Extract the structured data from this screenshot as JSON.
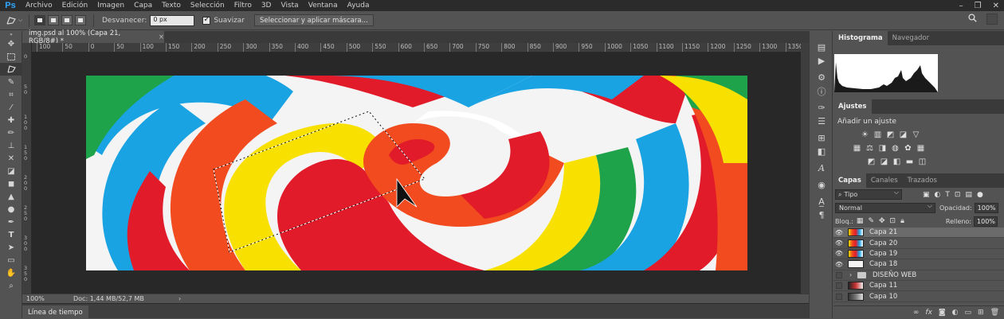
{
  "app": {
    "logo": "Ps"
  },
  "menu": [
    "Archivo",
    "Edición",
    "Imagen",
    "Capa",
    "Texto",
    "Selección",
    "Filtro",
    "3D",
    "Vista",
    "Ventana",
    "Ayuda"
  ],
  "window_controls": {
    "minimize": "–",
    "restore": "❐",
    "close": "✕"
  },
  "options_bar": {
    "feather_label": "Desvanecer:",
    "feather_value": "0 px",
    "antialias_label": "Suavizar",
    "antialias_checked": true,
    "select_mask_label": "Seleccionar y aplicar máscara..."
  },
  "document": {
    "tab_title": "img.psd al 100% (Capa 21, RGB/8#) *",
    "tab_close": "×",
    "ruler_top": [
      "100",
      "50",
      "0",
      "50",
      "100",
      "150",
      "200",
      "250",
      "300",
      "350",
      "400",
      "450",
      "500",
      "550",
      "600",
      "650",
      "700",
      "750",
      "800",
      "850",
      "900",
      "950",
      "1000",
      "1050",
      "1100",
      "1150",
      "1200",
      "1250",
      "1300",
      "1350"
    ],
    "ruler_left": [
      "0",
      "5 0",
      "1 0 0",
      "1 5 0",
      "2 0 0",
      "2 5 0",
      "3 0 0",
      "3 5 0"
    ],
    "zoom": "100%",
    "doc_size": "Doc: 1,44 MB/52,7 MB",
    "status_arrow": "›"
  },
  "timeline": {
    "label": "Línea de tiempo"
  },
  "panels": {
    "histogram_tabs": [
      "Histograma",
      "Navegador"
    ],
    "adjustments": {
      "tab": "Ajustes",
      "title": "Añadir un ajuste"
    },
    "layers_tabs": [
      "Capas",
      "Canales",
      "Trazados"
    ],
    "layer_filter": "Tipo",
    "blend_mode": "Normal",
    "opacity_label": "Opacidad:",
    "opacity_value": "100%",
    "lock_label": "Bloq.:",
    "fill_label": "Relleno:",
    "fill_value": "100%",
    "layers": [
      {
        "name": "Capa 21",
        "visible": true,
        "selected": true,
        "type": "layer"
      },
      {
        "name": "Capa 20",
        "visible": true,
        "selected": false,
        "type": "layer"
      },
      {
        "name": "Capa 19",
        "visible": true,
        "selected": false,
        "type": "layer"
      },
      {
        "name": "Capa 18",
        "visible": true,
        "selected": false,
        "type": "layer"
      },
      {
        "name": "DISEÑO WEB",
        "visible": false,
        "selected": false,
        "type": "group"
      },
      {
        "name": "Capa 11",
        "visible": false,
        "selected": false,
        "type": "layer"
      },
      {
        "name": "Capa 10",
        "visible": false,
        "selected": false,
        "type": "layer"
      }
    ]
  },
  "colors": {
    "menubar": "#2b2b2b",
    "panel": "#535353",
    "accent": "#31a8ff",
    "canvas_bg": "#282828"
  }
}
